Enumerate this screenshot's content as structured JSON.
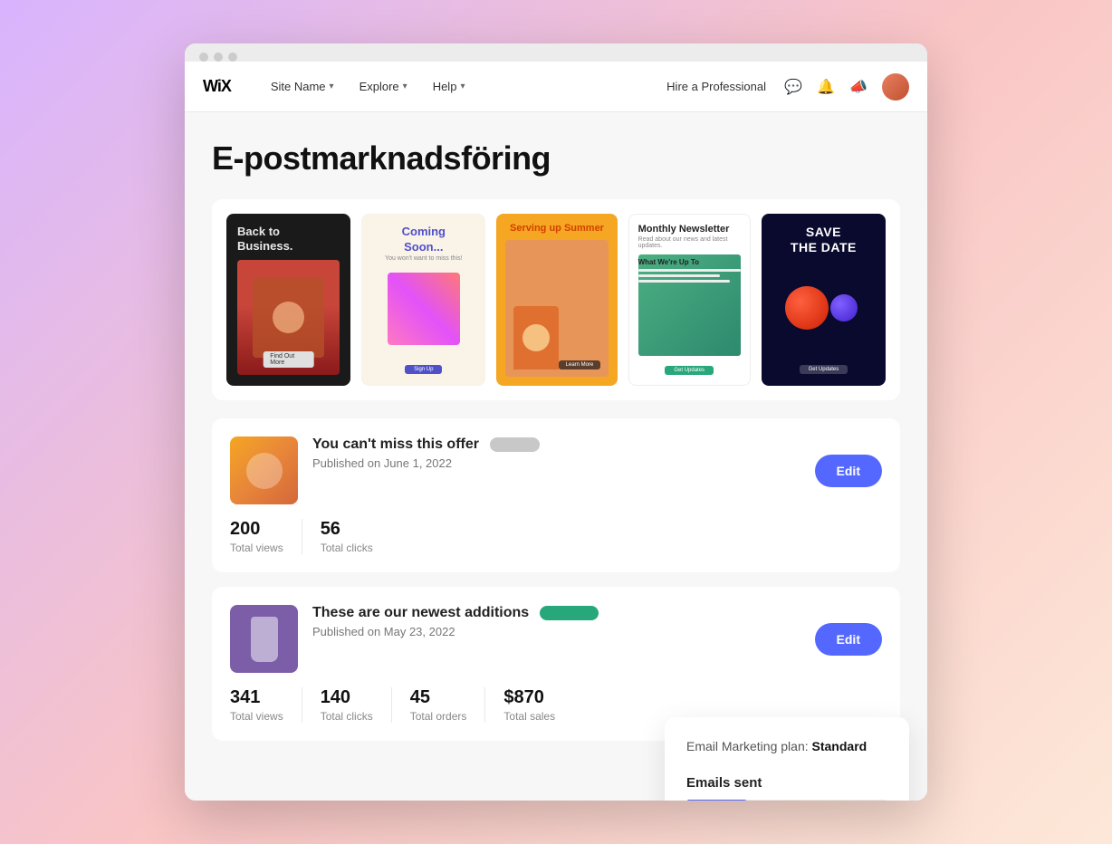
{
  "browser": {
    "dots": [
      "dot1",
      "dot2",
      "dot3"
    ]
  },
  "nav": {
    "logo": "WiX",
    "site_name": "Site Name",
    "explore": "Explore",
    "help": "Help",
    "hire": "Hire a Professional"
  },
  "page": {
    "title": "E-postmarknadsföring"
  },
  "templates": [
    {
      "id": "t1",
      "title": "Back to Business.",
      "style": "dark"
    },
    {
      "id": "t2",
      "title": "Coming Soon...",
      "sub": "You won't want to miss this!",
      "style": "light"
    },
    {
      "id": "t3",
      "title": "Serving up Summer",
      "style": "orange"
    },
    {
      "id": "t4",
      "title": "Monthly Newsletter",
      "sub": "Read about our news and latest updates.",
      "style": "white"
    },
    {
      "id": "t5",
      "title": "SAVE THE DATE",
      "style": "dark-blue"
    }
  ],
  "campaigns": [
    {
      "id": "campaign1",
      "name": "You can't miss this offer",
      "status": "pending",
      "date": "Published on June 1, 2022",
      "stats": [
        {
          "value": "200",
          "label": "Total views"
        },
        {
          "value": "56",
          "label": "Total clicks"
        }
      ],
      "edit_label": "Edit"
    },
    {
      "id": "campaign2",
      "name": "These are our newest additions",
      "status": "active",
      "date": "Published on May 23, 2022",
      "stats": [
        {
          "value": "341",
          "label": "Total views"
        },
        {
          "value": "140",
          "label": "Total clicks"
        },
        {
          "value": "45",
          "label": "Total orders"
        },
        {
          "value": "$870",
          "label": "Total sales"
        }
      ],
      "edit_label": "Edit"
    }
  ],
  "sidebar": {
    "plan_label": "Email Marketing plan:",
    "plan_name": "Standard",
    "emails_sent_label": "Emails sent",
    "progress_pct": 30
  }
}
